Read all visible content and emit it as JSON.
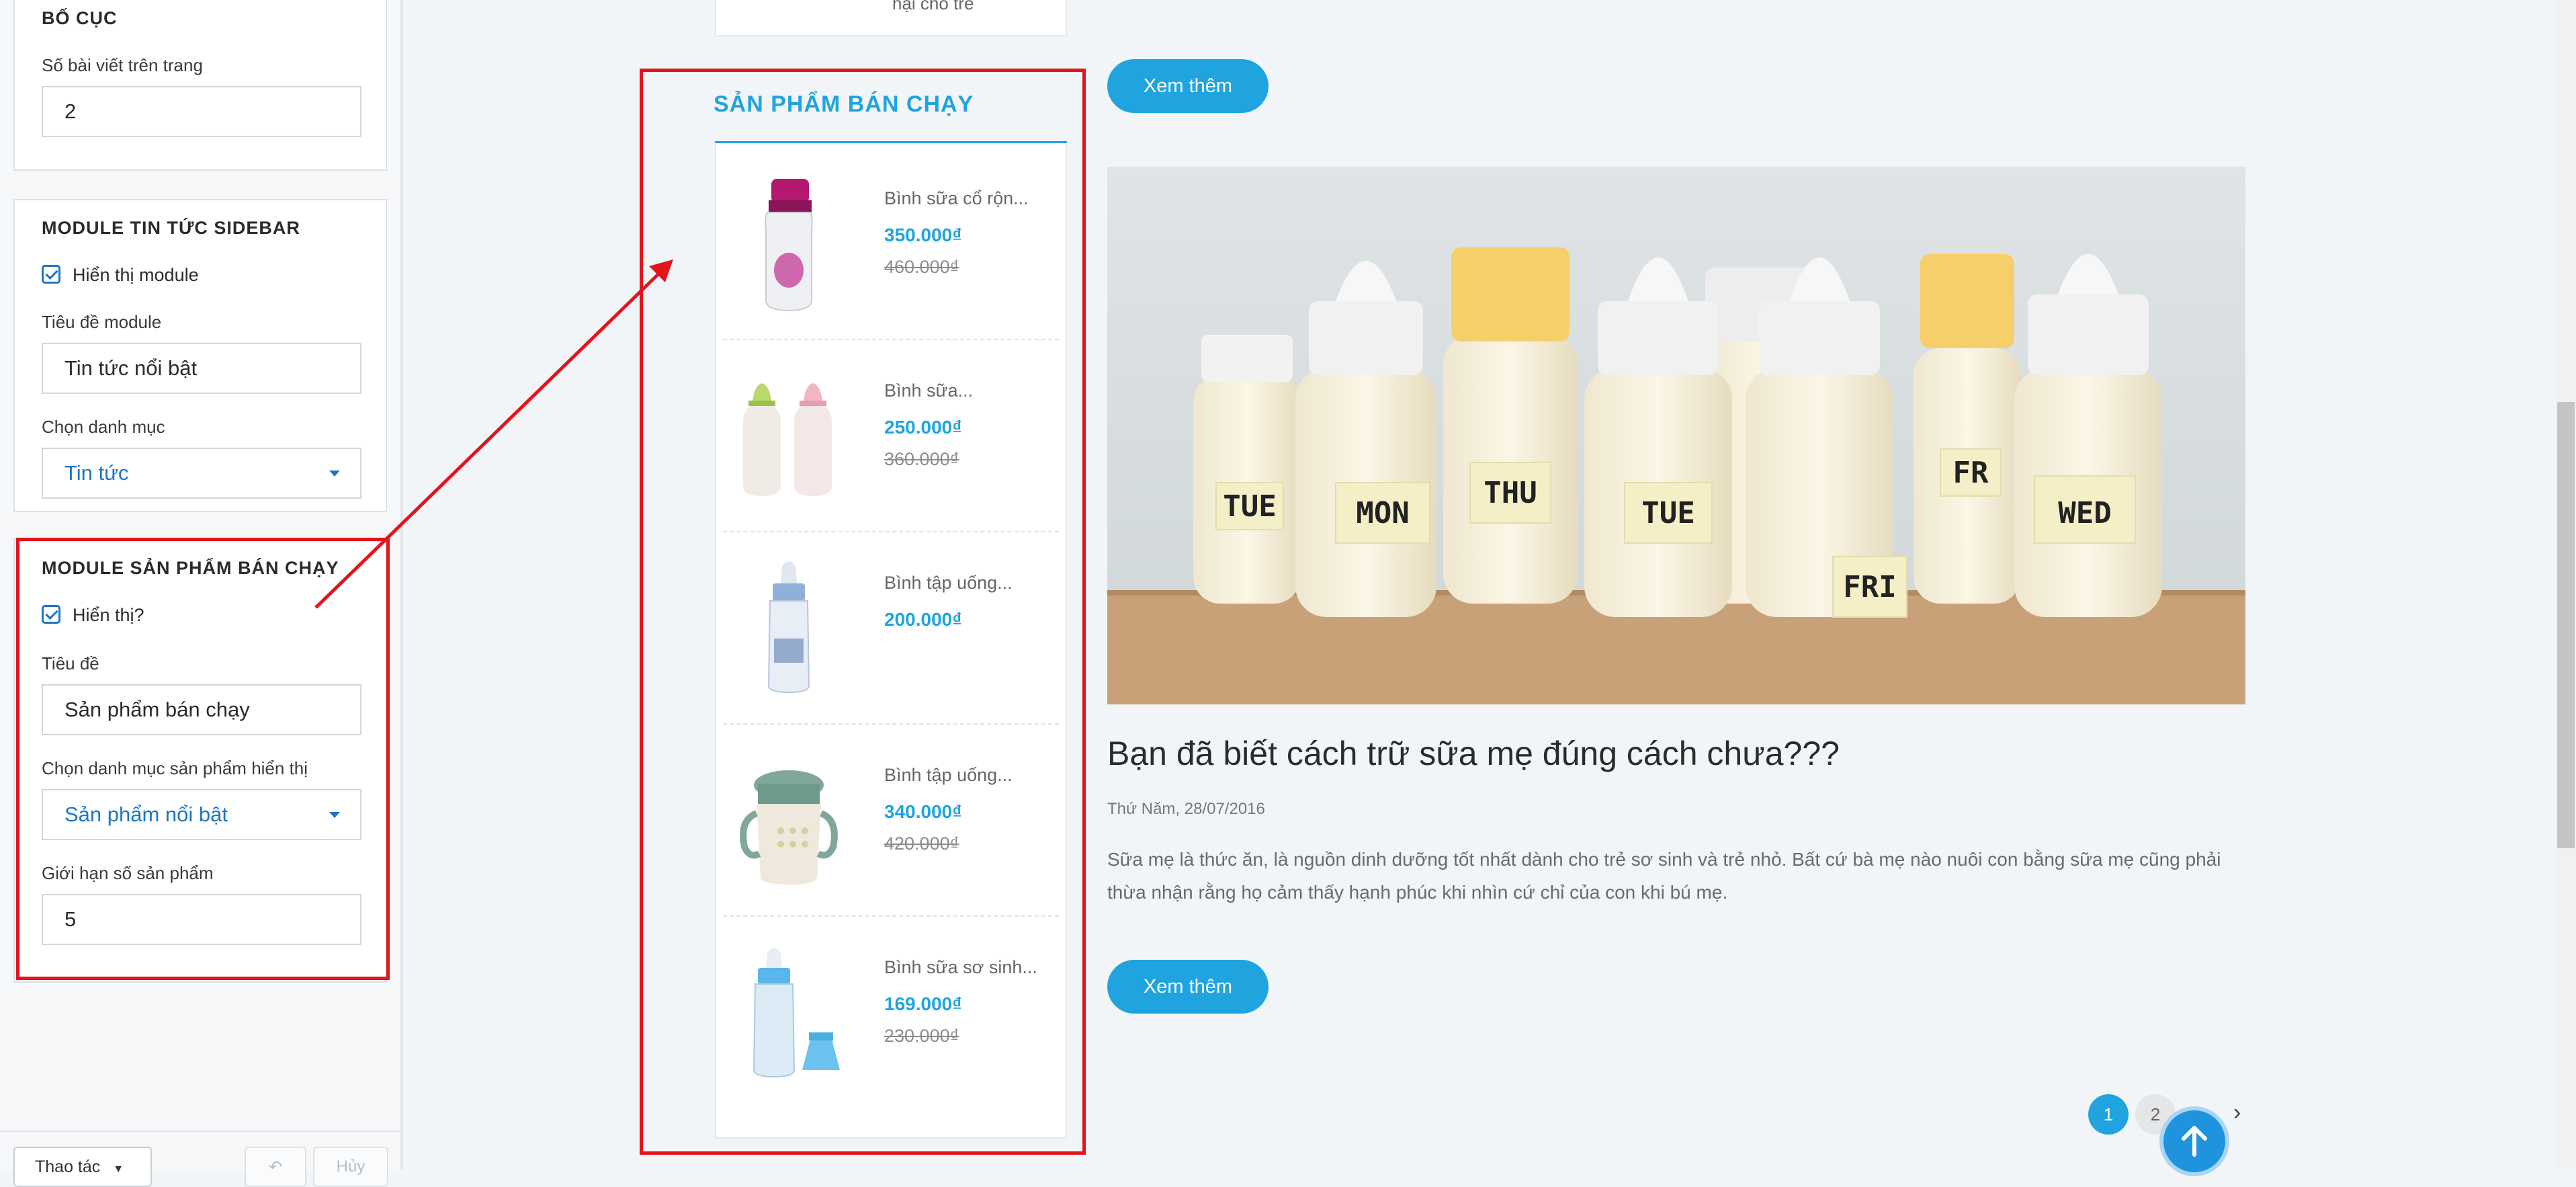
{
  "sidebar": {
    "layout": {
      "title": "BỐ CỤC",
      "posts_per_page_label": "Số bài viết trên trang",
      "posts_per_page_value": "2"
    },
    "news_module": {
      "title": "MODULE TIN TỨC SIDEBAR",
      "show_label": "Hiển thị module",
      "show_checked": true,
      "module_title_label": "Tiêu đề module",
      "module_title_value": "Tin tức nổi bật",
      "category_label": "Chọn danh mục",
      "category_value": "Tin tức"
    },
    "bestseller_module": {
      "title": "MODULE SẢN PHẨM BÁN CHẠY",
      "show_label": "Hiển thị?",
      "show_checked": true,
      "title_label": "Tiêu đề",
      "title_value": "Sản phẩm bán chạy",
      "category_label": "Chọn danh mục sản phẩm hiển thị",
      "category_value": "Sản phẩm nổi bật",
      "limit_label": "Giới hạn số sản phẩm",
      "limit_value": "5"
    },
    "footer": {
      "actions_label": "Thao tác",
      "undo_label": "",
      "cancel_label": "Hủy"
    }
  },
  "main": {
    "top_card_text": "hại cho trẻ",
    "bestseller": {
      "title": "SẢN PHẨM BÁN CHẠY",
      "products": [
        {
          "name": "Bình sữa cổ rộn...",
          "price": "350.000₫",
          "old_price": "460.000₫"
        },
        {
          "name": "Bình sữa...",
          "price": "250.000₫",
          "old_price": "360.000₫"
        },
        {
          "name": "Bình tập uống...",
          "price": "200.000₫",
          "old_price": ""
        },
        {
          "name": "Bình tập uống...",
          "price": "340.000₫",
          "old_price": "420.000₫"
        },
        {
          "name": "Bình sữa sơ sinh...",
          "price": "169.000₫",
          "old_price": "230.000₫"
        }
      ]
    },
    "read_more_label": "Xem thêm",
    "post": {
      "title": "Bạn đã biết cách trữ sữa mẹ đúng cách chưa???",
      "date": "Thứ Năm, 28/07/2016",
      "excerpt": "Sữa mẹ là thức ăn, là nguồn dinh dưỡng tốt nhất dành cho trẻ sơ sinh và trẻ nhỏ. Bất cứ bà mẹ nào nuôi con bằng sữa mẹ cũng phải thừa nhận rằng họ cảm thấy hạnh phúc khi nhìn cứ chỉ của con khi bú mẹ.",
      "bottle_labels": [
        "TUE",
        "MON",
        "THU",
        "TUE",
        "FR",
        "WED",
        "FRI"
      ]
    },
    "pagination": {
      "pages": [
        "1",
        "2"
      ],
      "current": "1",
      "next_icon": "chevron-right-icon"
    }
  },
  "colors": {
    "accent": "#1fa4e0",
    "annotation": "#e3141c",
    "select_text": "#1a76c7"
  }
}
